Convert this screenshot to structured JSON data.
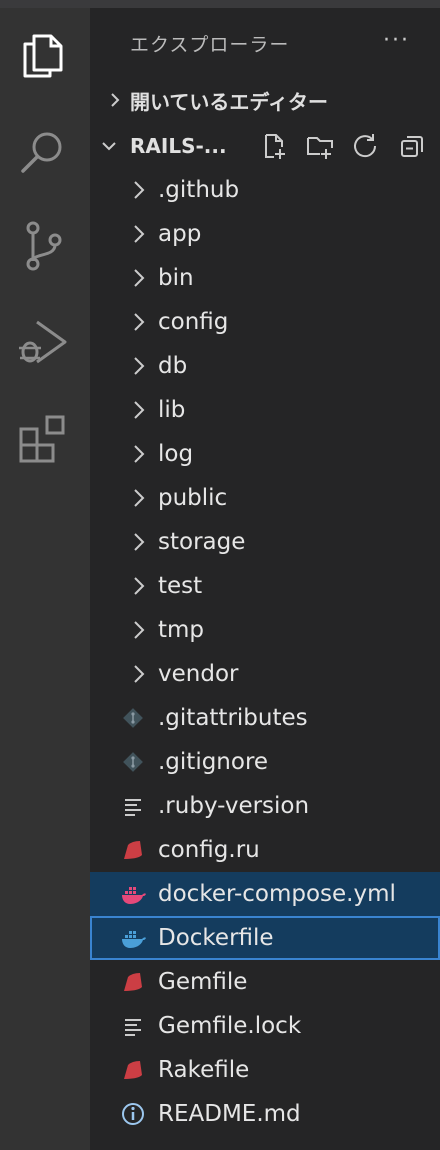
{
  "explorer": {
    "title": "エクスプローラー",
    "more": "···"
  },
  "sections": {
    "open_editors": "開いているエディター",
    "project": "RAILS-..."
  },
  "tree": [
    {
      "label": ".github",
      "kind": "folder"
    },
    {
      "label": "app",
      "kind": "folder"
    },
    {
      "label": "bin",
      "kind": "folder"
    },
    {
      "label": "config",
      "kind": "folder"
    },
    {
      "label": "db",
      "kind": "folder"
    },
    {
      "label": "lib",
      "kind": "folder"
    },
    {
      "label": "log",
      "kind": "folder"
    },
    {
      "label": "public",
      "kind": "folder"
    },
    {
      "label": "storage",
      "kind": "folder"
    },
    {
      "label": "test",
      "kind": "folder"
    },
    {
      "label": "tmp",
      "kind": "folder"
    },
    {
      "label": "vendor",
      "kind": "folder"
    },
    {
      "label": ".gitattributes",
      "kind": "git"
    },
    {
      "label": ".gitignore",
      "kind": "git"
    },
    {
      "label": ".ruby-version",
      "kind": "text"
    },
    {
      "label": "config.ru",
      "kind": "ruby"
    },
    {
      "label": "docker-compose.yml",
      "kind": "docker-compose"
    },
    {
      "label": "Dockerfile",
      "kind": "docker"
    },
    {
      "label": "Gemfile",
      "kind": "ruby"
    },
    {
      "label": "Gemfile.lock",
      "kind": "text"
    },
    {
      "label": "Rakefile",
      "kind": "ruby"
    },
    {
      "label": "README.md",
      "kind": "info"
    }
  ],
  "colors": {
    "ruby": "#cc3e44",
    "docker": "#4a9fd8",
    "docker_compose": "#e5497a",
    "git": "#41535b",
    "selection": "#143c5e",
    "focus_border": "#3a84d0"
  }
}
